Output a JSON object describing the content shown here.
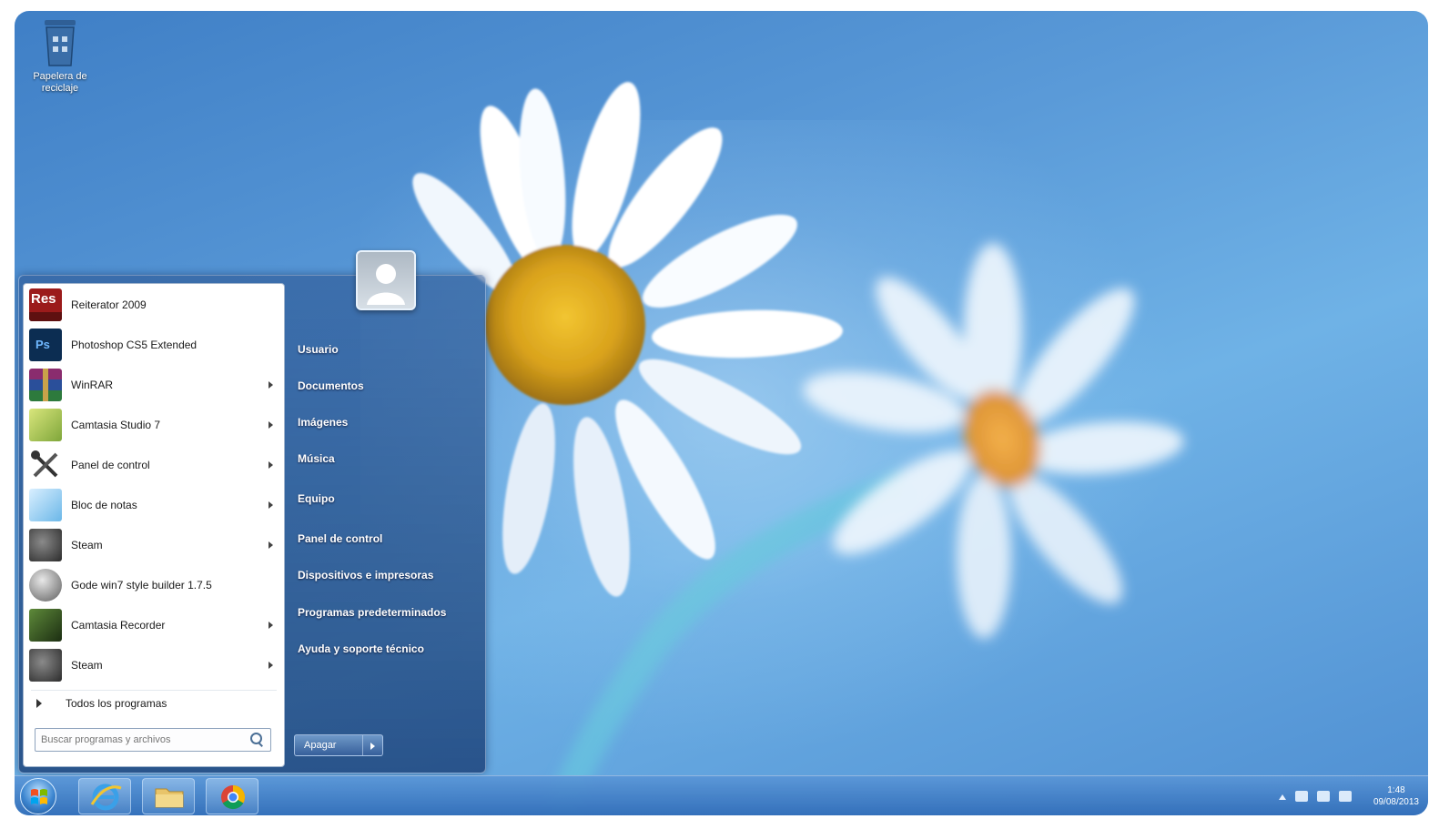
{
  "desktop": {
    "icon_label": "Papelera de reciclaje"
  },
  "start_menu": {
    "programs": [
      {
        "label": "Reiterator 2009",
        "icon": "res-icon",
        "has_submenu": false
      },
      {
        "label": "Photoshop CS5 Extended",
        "icon": "photoshop-icon",
        "has_submenu": false
      },
      {
        "label": "WinRAR",
        "icon": "winrar-icon",
        "has_submenu": true
      },
      {
        "label": "Camtasia Studio 7",
        "icon": "camtasia-studio-icon",
        "has_submenu": true
      },
      {
        "label": "Panel de control",
        "icon": "tools-icon",
        "has_submenu": true
      },
      {
        "label": "Bloc de notas",
        "icon": "notepad-icon",
        "has_submenu": true
      },
      {
        "label": "Steam",
        "icon": "steam-icon",
        "has_submenu": true
      },
      {
        "label": "Gode win7 style builder 1.7.5",
        "icon": "globe-icon",
        "has_submenu": false
      },
      {
        "label": "Camtasia Recorder",
        "icon": "camtasia-recorder-icon",
        "has_submenu": true
      },
      {
        "label": "Steam",
        "icon": "steam-icon",
        "has_submenu": true
      }
    ],
    "all_programs_label": "Todos los programas",
    "search_placeholder": "Buscar programas y archivos",
    "right_links": [
      "Usuario",
      "Documentos",
      "Imágenes",
      "Música",
      "Equipo",
      "Panel de control",
      "Dispositivos e impresoras",
      "Programas predeterminados",
      "Ayuda y soporte técnico"
    ],
    "shutdown_label": "Apagar"
  },
  "taskbar": {
    "pinned": [
      "internet-explorer-icon",
      "explorer-folder-icon",
      "chrome-icon"
    ],
    "clock_time": "1:48",
    "clock_date": "09/08/2013"
  },
  "colors": {
    "desktop_bg": "#4f8fd2",
    "start_menu_bg": "#1e4e8c",
    "taskbar_bg": "#3e7cc3"
  }
}
